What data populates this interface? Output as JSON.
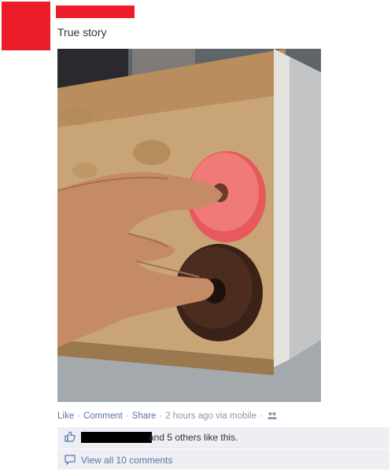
{
  "post": {
    "status_text": "True story",
    "photo_alt": "Photo"
  },
  "actions": {
    "like": "Like",
    "comment": "Comment",
    "share": "Share",
    "sep": "·",
    "time": "2 hours ago via mobile"
  },
  "likes": {
    "text": "and 5 others like this."
  },
  "comments": {
    "view_all": "View all 10 comments"
  },
  "icons": {
    "like": "thumbs-up-icon",
    "comment": "speech-bubble-icon",
    "privacy": "friends-globe-icon"
  },
  "colors": {
    "redaction_red": "#ec1c2b",
    "link_blue": "#5b74a8",
    "meta_gray": "#8f96a8",
    "ufi_bg": "#edeff4"
  }
}
